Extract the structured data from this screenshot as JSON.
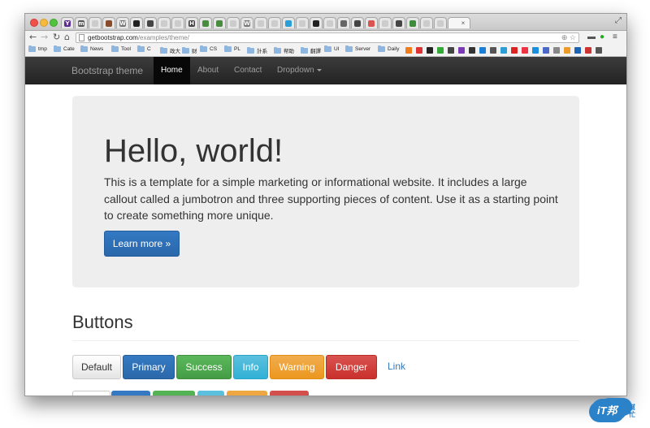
{
  "browser": {
    "url_host": "getbootstrap.com",
    "url_path": "/examples/theme/",
    "tabs": [
      {
        "icon": "Y",
        "color": "#5b2d8e"
      },
      {
        "icon": "m",
        "color": "#555555"
      },
      {
        "icon": "",
        "color": "#cccccc"
      },
      {
        "icon": "",
        "color": "#8a4b2a"
      },
      {
        "icon": "W",
        "color": "#777777"
      },
      {
        "icon": "",
        "color": "#222222"
      },
      {
        "icon": "",
        "color": "#444444"
      },
      {
        "icon": "",
        "color": "#cccccc"
      },
      {
        "icon": "",
        "color": "#cccccc"
      },
      {
        "icon": "H",
        "color": "#444444"
      },
      {
        "icon": "",
        "color": "#4a8c3f"
      },
      {
        "icon": "",
        "color": "#4a8c3f"
      },
      {
        "icon": "",
        "color": "#cccccc"
      },
      {
        "icon": "W",
        "color": "#777777"
      },
      {
        "icon": "",
        "color": "#cccccc"
      },
      {
        "icon": "",
        "color": "#cccccc"
      },
      {
        "icon": "",
        "color": "#2a9fd6"
      },
      {
        "icon": "",
        "color": "#cccccc"
      },
      {
        "icon": "",
        "color": "#222222"
      },
      {
        "icon": "",
        "color": "#cccccc"
      },
      {
        "icon": "",
        "color": "#666666"
      },
      {
        "icon": "",
        "color": "#444444"
      },
      {
        "icon": "",
        "color": "#d9534f"
      },
      {
        "icon": "",
        "color": "#cccccc"
      },
      {
        "icon": "",
        "color": "#444444"
      },
      {
        "icon": "",
        "color": "#3c8c3c"
      },
      {
        "icon": "",
        "color": "#cccccc"
      },
      {
        "icon": "",
        "color": "#cccccc"
      }
    ],
    "active_tab_close": "×",
    "bookmarks": [
      {
        "label": "tmp"
      },
      {
        "label": "Cate"
      },
      {
        "label": "News"
      },
      {
        "label": "Tool"
      },
      {
        "label": "C"
      },
      {
        "label": "政大"
      },
      {
        "label": "财"
      },
      {
        "label": "CS"
      },
      {
        "label": "PL"
      },
      {
        "label": "計系"
      },
      {
        "label": "帮助"
      },
      {
        "label": "翻譯"
      },
      {
        "label": "UI"
      },
      {
        "label": "Server"
      },
      {
        "label": "Daily"
      }
    ]
  },
  "navbar": {
    "brand": "Bootstrap theme",
    "links": [
      "Home",
      "About",
      "Contact",
      "Dropdown"
    ]
  },
  "jumbotron": {
    "title": "Hello, world!",
    "text": "This is a template for a simple marketing or informational website. It includes a large callout called a jumbotron and three supporting pieces of content. Use it as a starting point to create something more unique.",
    "button": "Learn more »"
  },
  "buttons_section": {
    "title": "Buttons",
    "buttons": [
      "Default",
      "Primary",
      "Success",
      "Info",
      "Warning",
      "Danger",
      "Link"
    ]
  },
  "watermark": {
    "text": "iT邦",
    "sub": "幫忙"
  }
}
